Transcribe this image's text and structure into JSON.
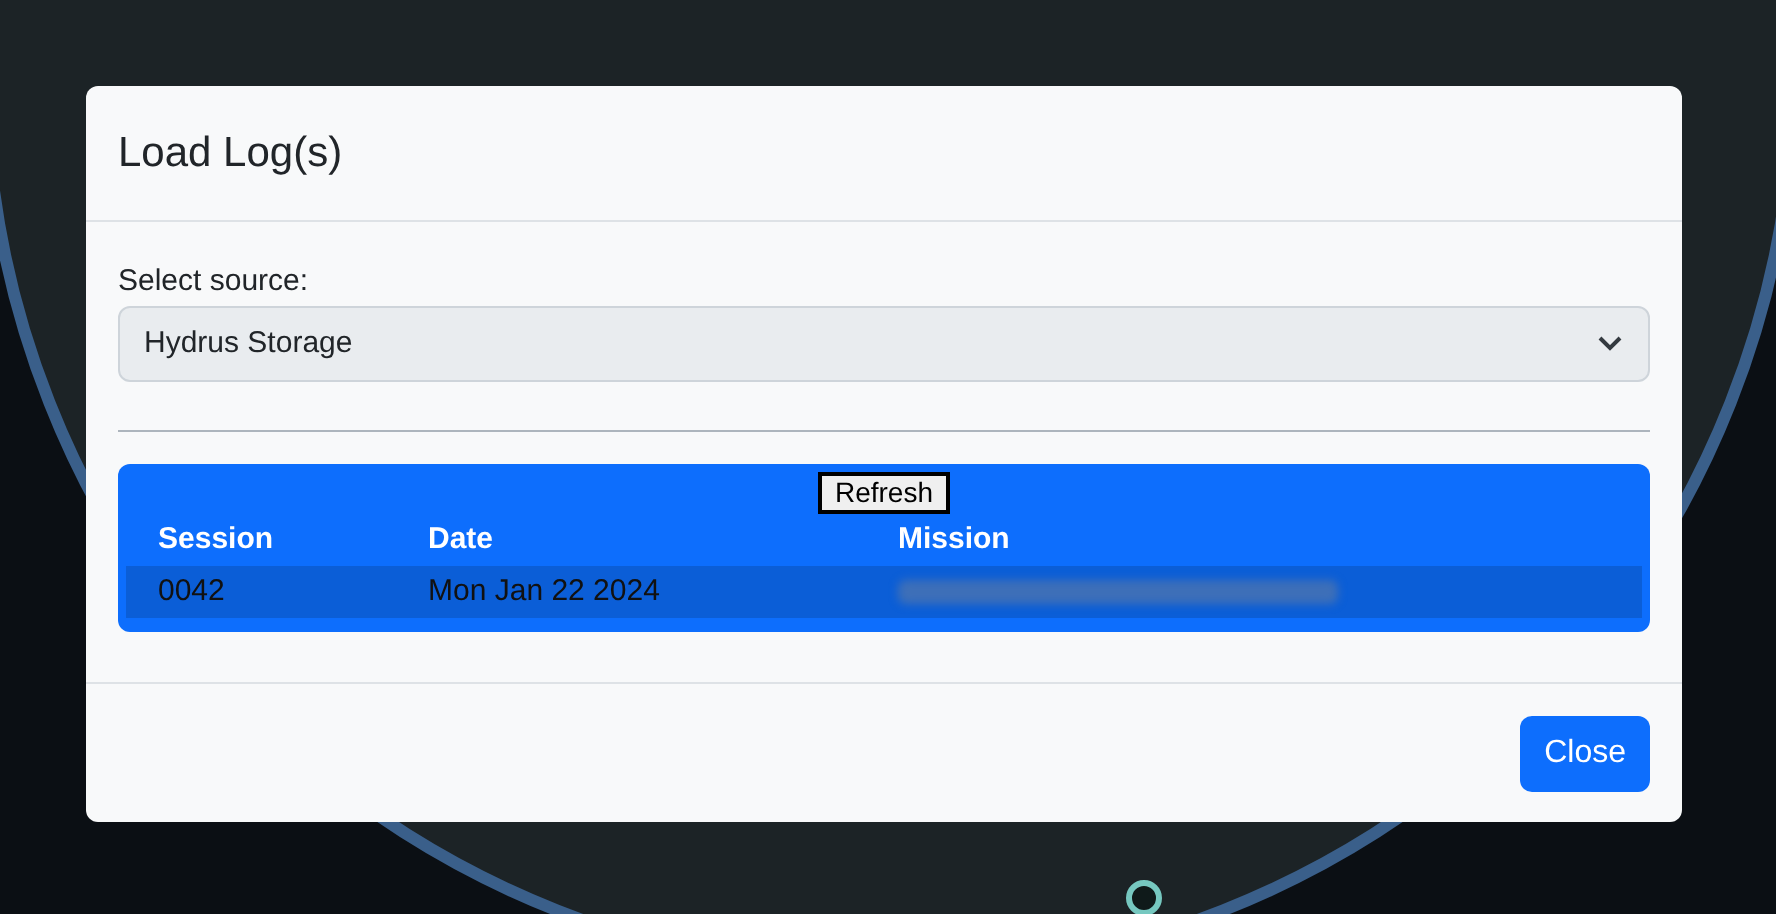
{
  "modal": {
    "title": "Load Log(s)",
    "source_label": "Select source:",
    "source_value": "Hydrus Storage",
    "refresh_button": "Refresh",
    "table": {
      "columns": [
        "Session",
        "Date",
        "Mission"
      ],
      "rows": [
        {
          "session": "0042",
          "date": "Mon Jan 22 2024",
          "selected": true
        }
      ]
    },
    "close_button": "Close"
  }
}
